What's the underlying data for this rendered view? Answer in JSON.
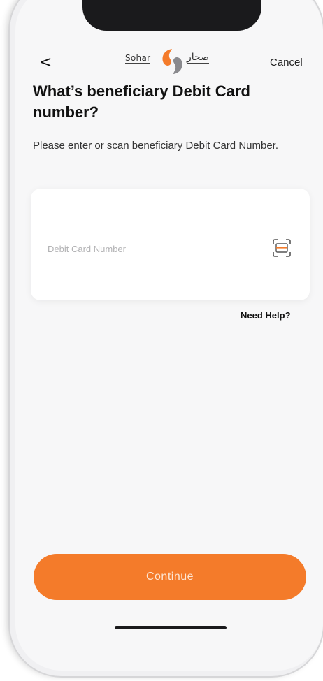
{
  "header": {
    "back_icon": "<",
    "logo_latin": "Sohar",
    "logo_arabic": "صحار",
    "cancel_label": "Cancel"
  },
  "main": {
    "title": "What’s beneficiary Debit Card number?",
    "subtitle": "Please enter or scan beneficiary Debit Card Number.",
    "card_input": {
      "placeholder": "Debit Card Number",
      "value": "",
      "scan_icon": "scan-card-icon"
    },
    "help_label": "Need Help?"
  },
  "footer": {
    "continue_label": "Continue"
  },
  "colors": {
    "accent": "#f47b2a",
    "background": "#f7f7f8",
    "card": "#ffffff"
  }
}
